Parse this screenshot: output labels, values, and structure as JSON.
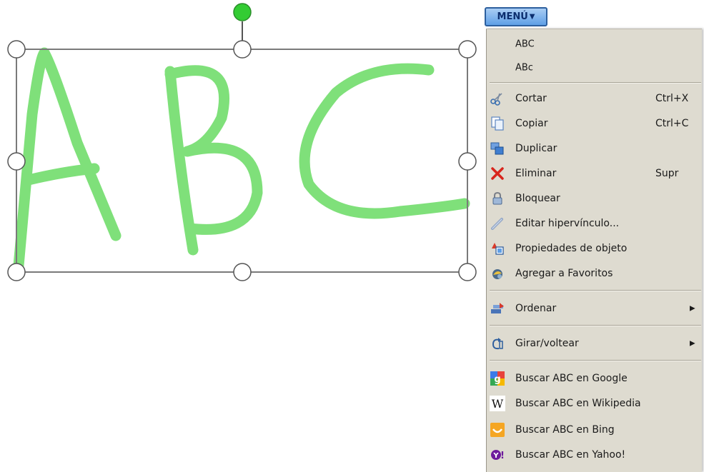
{
  "menu_button": {
    "label": "MENÚ"
  },
  "canvas": {
    "ink_color": "#7fe07a",
    "rotate_handle_color": "#33cc33"
  },
  "context_menu": {
    "texts": [
      "ABC",
      "ABc"
    ],
    "items": [
      {
        "label": "Cortar",
        "shortcut": "Ctrl+X",
        "icon": "scissors-icon"
      },
      {
        "label": "Copiar",
        "shortcut": "Ctrl+C",
        "icon": "copy-icon"
      },
      {
        "label": "Duplicar",
        "icon": "duplicate-icon"
      },
      {
        "label": "Eliminar",
        "shortcut": "Supr",
        "icon": "delete-icon"
      },
      {
        "label": "Bloquear",
        "icon": "lock-icon"
      },
      {
        "label": "Editar hipervínculo...",
        "icon": "hyperlink-icon"
      },
      {
        "label": "Propiedades de objeto",
        "icon": "properties-icon"
      },
      {
        "label": "Agregar a Favoritos",
        "icon": "favorites-icon"
      },
      {
        "label": "Ordenar",
        "icon": "order-icon"
      },
      {
        "label": "Girar/voltear",
        "icon": "rotate-icon"
      },
      {
        "label": "Buscar ABC en Google",
        "icon": "google-icon"
      },
      {
        "label": "Buscar ABC en Wikipedia",
        "icon": "wikipedia-icon"
      },
      {
        "label": "Buscar ABC en Bing",
        "icon": "bing-icon"
      },
      {
        "label": "Buscar ABC en Yahoo!",
        "icon": "yahoo-icon"
      }
    ]
  }
}
